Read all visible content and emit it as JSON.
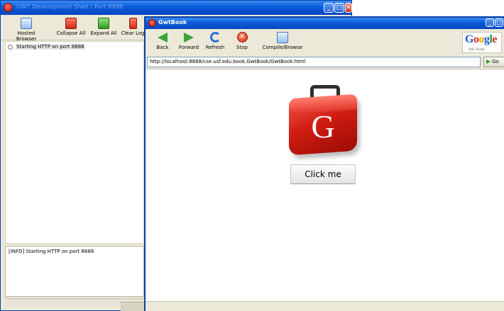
{
  "shell": {
    "title": "GWT Development Shell / Port 8888",
    "toolbar": {
      "hosted_browser": "Hosted Browser",
      "collapse_all": "Collapse All",
      "expand_all": "Expand All",
      "clear_log": "Clear Log"
    },
    "tree": {
      "item": "Starting HTTP on port 8888"
    },
    "log": {
      "line": "[INFO] Starting HTTP on port 8888"
    }
  },
  "browser": {
    "title": "GwtBook",
    "toolbar": {
      "back": "Back",
      "forward": "Forward",
      "refresh": "Refresh",
      "stop": "Stop",
      "compile": "Compile/Browse"
    },
    "google": {
      "g1": "G",
      "o1": "o",
      "o2": "o",
      "g2": "g",
      "l": "l",
      "e": "e",
      "sub": "Web Toolkit",
      "colors": {
        "blue": "#1a56d6",
        "red": "#d62d20",
        "yellow": "#e8a400",
        "green": "#1d9b2c"
      }
    },
    "url": "http://localhost:8888/cse.usf.edu.book.GwtBook/GwtBook.html",
    "go_label": "Go",
    "logo_letter": "G",
    "click_button": "Click me"
  },
  "window_buttons": {
    "min": "_",
    "max": "□",
    "close": "✕"
  }
}
